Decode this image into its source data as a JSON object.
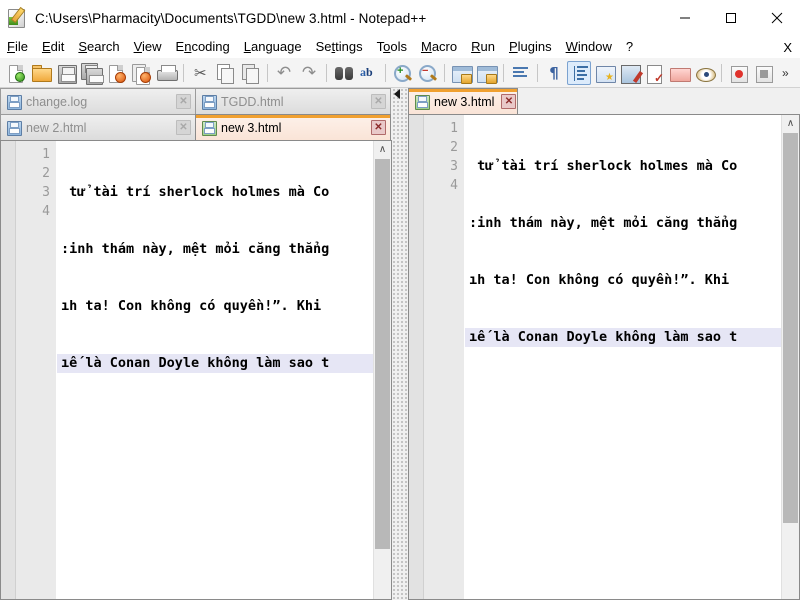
{
  "window": {
    "title": "C:\\Users\\Pharmacity\\Documents\\TGDD\\new 3.html - Notepad++",
    "app_icon": "notepad-plus-plus-icon",
    "controls": {
      "minimize": "—",
      "maximize": "☐",
      "close": "✕"
    }
  },
  "menu": {
    "items": [
      {
        "label": "File",
        "accel": "F"
      },
      {
        "label": "Edit",
        "accel": "E"
      },
      {
        "label": "Search",
        "accel": "S"
      },
      {
        "label": "View",
        "accel": "V"
      },
      {
        "label": "Encoding",
        "accel": "n"
      },
      {
        "label": "Language",
        "accel": "L"
      },
      {
        "label": "Settings",
        "accel": "t"
      },
      {
        "label": "Tools",
        "accel": "o"
      },
      {
        "label": "Macro",
        "accel": "M"
      },
      {
        "label": "Run",
        "accel": "R"
      },
      {
        "label": "Plugins",
        "accel": "P"
      },
      {
        "label": "Window",
        "accel": "W"
      },
      {
        "label": "?",
        "accel": ""
      }
    ],
    "close_document_label": "X"
  },
  "toolbar": {
    "items": [
      {
        "name": "new-file-icon",
        "type": "icon"
      },
      {
        "name": "open-file-icon",
        "type": "icon"
      },
      {
        "name": "save-icon",
        "type": "icon"
      },
      {
        "name": "save-all-icon",
        "type": "icon"
      },
      {
        "name": "close-file-icon",
        "type": "icon"
      },
      {
        "name": "close-all-files-icon",
        "type": "icon"
      },
      {
        "name": "print-icon",
        "type": "icon"
      },
      {
        "name": "separator-1",
        "type": "separator"
      },
      {
        "name": "cut-icon",
        "type": "icon"
      },
      {
        "name": "copy-icon",
        "type": "icon"
      },
      {
        "name": "paste-icon",
        "type": "icon"
      },
      {
        "name": "separator-2",
        "type": "separator"
      },
      {
        "name": "undo-icon",
        "type": "icon"
      },
      {
        "name": "redo-icon",
        "type": "icon"
      },
      {
        "name": "separator-3",
        "type": "separator"
      },
      {
        "name": "find-icon",
        "type": "icon"
      },
      {
        "name": "replace-icon",
        "type": "icon"
      },
      {
        "name": "separator-4",
        "type": "separator"
      },
      {
        "name": "zoom-in-icon",
        "type": "icon"
      },
      {
        "name": "zoom-out-icon",
        "type": "icon"
      },
      {
        "name": "separator-5",
        "type": "separator"
      },
      {
        "name": "sync-vertical-scrolling-icon",
        "type": "icon"
      },
      {
        "name": "sync-horizontal-scrolling-icon",
        "type": "icon"
      },
      {
        "name": "separator-6",
        "type": "separator"
      },
      {
        "name": "word-wrap-icon",
        "type": "icon"
      },
      {
        "name": "separator-7",
        "type": "separator"
      },
      {
        "name": "show-all-characters-icon",
        "type": "icon"
      },
      {
        "name": "show-indent-guide-icon",
        "type": "icon",
        "active": true
      },
      {
        "name": "user-defined-dialog-icon",
        "type": "icon"
      },
      {
        "name": "document-map-icon",
        "type": "icon"
      },
      {
        "name": "function-list-icon",
        "type": "icon"
      },
      {
        "name": "folder-as-workspace-icon",
        "type": "icon"
      },
      {
        "name": "document-monitoring-icon",
        "type": "icon"
      },
      {
        "name": "separator-8",
        "type": "separator"
      },
      {
        "name": "start-recording-macro-icon",
        "type": "icon"
      },
      {
        "name": "stop-recording-macro-icon",
        "type": "icon"
      }
    ],
    "overflow_label": "»"
  },
  "left_pane": {
    "tab_rows": [
      [
        {
          "label": "change.log",
          "active": false,
          "modified": false
        },
        {
          "label": "TGDD.html",
          "active": false,
          "modified": false
        }
      ],
      [
        {
          "label": "new 2.html",
          "active": false,
          "modified": false
        },
        {
          "label": "new 3.html",
          "active": true,
          "modified": false
        }
      ]
    ],
    "close_tab_label": "✕",
    "line_numbers": [
      "1",
      "2",
      "3",
      "4"
    ],
    "lines": [
      " tử tài trí sherlock holmes mà Co",
      ":inh thám này, mệt mỏi căng thẳng",
      "ıh ta! Con không có quyền!”. Khi",
      "ıế là Conan Doyle không làm sao t"
    ],
    "highlighted_line_index": 3,
    "scrollbar_up_label": "∧"
  },
  "right_pane": {
    "tab_rows": [
      [
        {
          "label": "new 3.html",
          "active": true,
          "modified": false
        }
      ]
    ],
    "close_tab_label": "✕",
    "line_numbers": [
      "1",
      "2",
      "3",
      "4"
    ],
    "lines": [
      " tử tài trí sherlock holmes mà Co",
      ":inh thám này, mệt mỏi căng thẳng",
      "ıh ta! Con không có quyền!”. Khi",
      "ıế là Conan Doyle không làm sao t"
    ],
    "highlighted_line_index": 3,
    "scrollbar_up_label": "∧"
  },
  "splitter": {
    "collapse_arrow": "◀"
  },
  "colors": {
    "active_tab_bar": "#f0a030",
    "active_tab_bg": "#fae4d7",
    "current_line_highlight": "#e6e6f5",
    "gutter_bg": "#eaeaea",
    "toolbar_bg": "#f4f4f4",
    "pressed_button_border": "#7ba2d0"
  }
}
